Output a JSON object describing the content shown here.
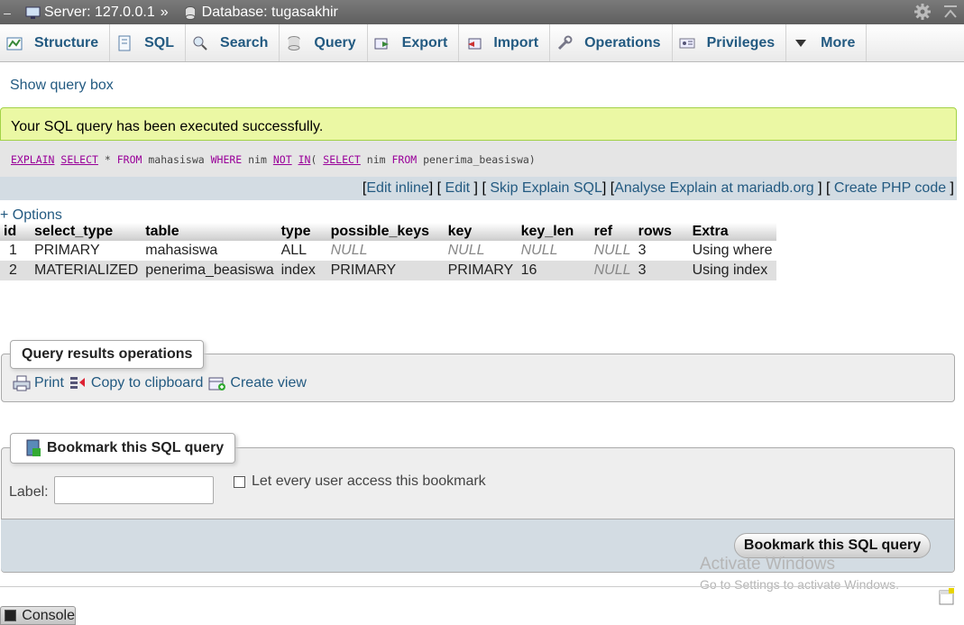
{
  "breadcrumb": {
    "dash": "–",
    "server": "Server: 127.0.0.1",
    "separator": "»",
    "database": "Database: tugasakhir"
  },
  "tabs": [
    {
      "label": "Structure",
      "icon": "structure-icon"
    },
    {
      "label": "SQL",
      "icon": "sql-icon"
    },
    {
      "label": "Search",
      "icon": "search-icon"
    },
    {
      "label": "Query",
      "icon": "query-icon"
    },
    {
      "label": "Export",
      "icon": "export-icon"
    },
    {
      "label": "Import",
      "icon": "import-icon"
    },
    {
      "label": "Operations",
      "icon": "wrench-icon"
    },
    {
      "label": "Privileges",
      "icon": "privileges-icon"
    },
    {
      "label": "More",
      "icon": "triangle-down-icon"
    }
  ],
  "show_query_box": "Show query box",
  "success_message": "Your SQL query has been executed successfully.",
  "sql": {
    "t1": "EXPLAIN",
    "t2": "SELECT",
    "t3": " * ",
    "t4": "FROM",
    "t5": " mahasiswa ",
    "t6": "WHERE",
    "t7": " nim ",
    "t8": "NOT",
    "t9": " ",
    "t10": "IN",
    "t11": "( ",
    "t12": "SELECT",
    "t13": " nim ",
    "t14": "FROM",
    "t15": " penerima_beasiswa)"
  },
  "sql_links": {
    "edit_inline": "Edit inline",
    "edit": "Edit",
    "skip_explain": "Skip Explain SQL",
    "analyse": "Analyse Explain at mariadb.org",
    "create_php": "Create PHP code"
  },
  "options_label": "+ Options",
  "results": {
    "columns": [
      "id",
      "select_type",
      "table",
      "type",
      "possible_keys",
      "key",
      "key_len",
      "ref",
      "rows",
      "Extra"
    ],
    "rows": [
      [
        "1",
        "PRIMARY",
        "mahasiswa",
        "ALL",
        "NULL",
        "NULL",
        "NULL",
        "NULL",
        "3",
        "Using where"
      ],
      [
        "2",
        "MATERIALIZED",
        "penerima_beasiswa",
        "index",
        "PRIMARY",
        "PRIMARY",
        "16",
        "NULL",
        "3",
        "Using index"
      ]
    ]
  },
  "query_ops": {
    "legend": "Query results operations",
    "print": "Print",
    "copy": "Copy to clipboard",
    "create_view": "Create view"
  },
  "bookmark": {
    "legend": "Bookmark this SQL query",
    "label": "Label:",
    "label_value": "",
    "checkbox_label": "Let every user access this bookmark",
    "button": "Bookmark this SQL query"
  },
  "watermark": {
    "line1": "Activate Windows",
    "line2": "Go to Settings to activate Windows."
  },
  "console_label": "Console"
}
